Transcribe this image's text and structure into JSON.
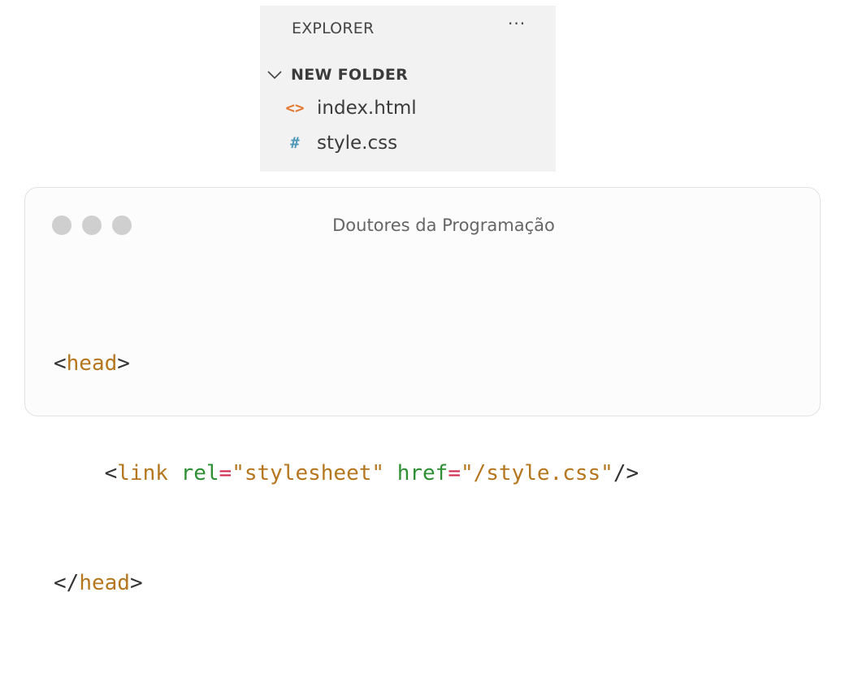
{
  "explorer": {
    "title": "EXPLORER",
    "more_label": "···",
    "folder": {
      "name": "NEW FOLDER",
      "expanded": true
    },
    "files": [
      {
        "icon": "html-file-icon",
        "glyph": "<>",
        "name": "index.html",
        "icon_color": "#e37933"
      },
      {
        "icon": "css-file-icon",
        "glyph": "#",
        "name": "style.css",
        "icon_color": "#519aba"
      }
    ]
  },
  "code_card": {
    "title": "Doutores da Programação",
    "window_dots": [
      "#cfcfcf",
      "#cfcfcf",
      "#cfcfcf"
    ],
    "lines": {
      "l1": {
        "open": "<",
        "tag": "head",
        "close": ">"
      },
      "l2": {
        "indent": "    ",
        "open": "<",
        "tag": "link",
        "attr1": "rel",
        "eq1": "=",
        "val1": "\"stylesheet\"",
        "attr2": "href",
        "eq2": "=",
        "val2": "\"/style.css\"",
        "close": "/>"
      },
      "l3": {
        "open": "</",
        "tag": "head",
        "close": ">"
      }
    },
    "colors": {
      "tag": "#b5761e",
      "attribute": "#2e8f34",
      "equals": "#d12a4d",
      "string": "#b5761e"
    }
  }
}
